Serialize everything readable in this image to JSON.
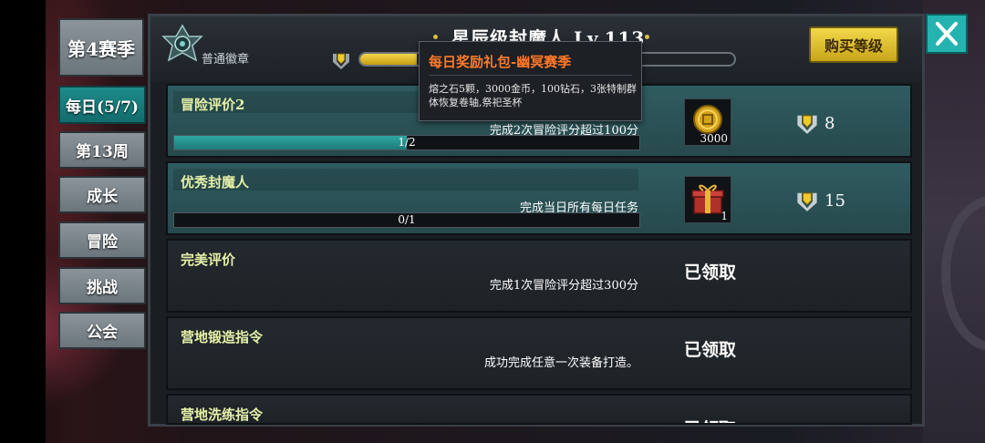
{
  "season_tab": "第4赛季",
  "tabs": [
    {
      "label": "每日(5/7)",
      "active": true
    },
    {
      "label": "第13周",
      "active": false
    },
    {
      "label": "成长",
      "active": false
    },
    {
      "label": "冒险",
      "active": false
    },
    {
      "label": "挑战",
      "active": false
    },
    {
      "label": "公会",
      "active": false
    }
  ],
  "header": {
    "emblem_label": "普通徽章",
    "title": "星辰级封魔人 Lv.113",
    "xp_fraction": 0.15,
    "buy_button": "购买等级"
  },
  "tooltip": {
    "title": "每日奖励礼包-幽冥赛季",
    "body": "熔之石5颗，3000金币，100钻石，3张特制群体恢复卷轴,祭祀圣杯"
  },
  "tasks": [
    {
      "title": "冒险评价2",
      "desc": "完成2次冒险评分超过100分",
      "progress_text": "1/2",
      "progress": 0.5,
      "reward_icon": "gold-coin-icon",
      "reward_qty": "3000",
      "points": "8",
      "status": "unclaimed"
    },
    {
      "title": "优秀封魔人",
      "desc": "完成当日所有每日任务",
      "progress_text": "0/1",
      "progress": 0,
      "reward_icon": "gift-box-icon",
      "reward_qty": "1",
      "points": "15",
      "status": "unclaimed"
    },
    {
      "title": "完美评价",
      "desc": "完成1次冒险评分超过300分",
      "status": "claimed",
      "status_label": "已领取"
    },
    {
      "title": "营地锻造指令",
      "desc": "成功完成任意一次装备打造。",
      "status": "claimed",
      "status_label": "已领取"
    },
    {
      "title": "营地洗练指令",
      "desc": "",
      "status": "claimed",
      "status_label": "已领取"
    }
  ],
  "colors": {
    "accent_teal": "#1d8b8a",
    "gold": "#f2d84a",
    "tooltip_title": "#ff7a2a"
  }
}
